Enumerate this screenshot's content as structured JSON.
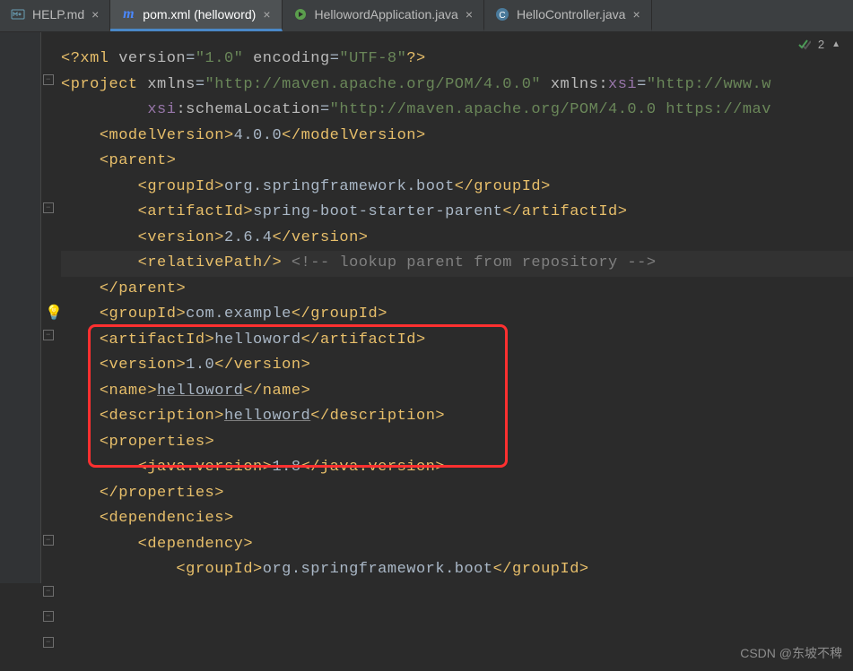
{
  "tabs": [
    {
      "label": "HELP.md",
      "active": false,
      "icon": "md"
    },
    {
      "label": "pom.xml (helloword)",
      "active": true,
      "icon": "maven"
    },
    {
      "label": "HellowordApplication.java",
      "active": false,
      "icon": "spring"
    },
    {
      "label": "HelloController.java",
      "active": false,
      "icon": "class"
    }
  ],
  "inspection": {
    "count": "2"
  },
  "code": {
    "xml_decl_kw": "?xml",
    "xml_decl_version_attr": "version",
    "xml_decl_version_val": "\"1.0\"",
    "xml_decl_enc_attr": "encoding",
    "xml_decl_enc_val": "\"UTF-8\"",
    "project": "project",
    "xmlns_attr": "xmlns",
    "xmlns_val": "\"http://maven.apache.org/POM/4.0.0\"",
    "xmlns_xsi_prefix": "xmlns:",
    "xmlns_xsi_name": "xsi",
    "xmlns_xsi_val": "\"http://www.w",
    "xsi_prefix": "xsi",
    "schema_attr": ":schemaLocation",
    "schema_val": "\"http://maven.apache.org/POM/4.0.0 https://mav",
    "modelVersion_tag": "modelVersion",
    "modelVersion_val": "4.0.0",
    "parent_tag": "parent",
    "groupId_tag": "groupId",
    "parent_groupId_val": "org.springframework.boot",
    "artifactId_tag": "artifactId",
    "parent_artifactId_val": "spring-boot-starter-parent",
    "version_tag": "version",
    "parent_version_val": "2.6.4",
    "relativePath_tag": "relativePath",
    "relativePath_cmt": "<!-- lookup parent from repository -->",
    "proj_groupId_val": "com.example",
    "proj_artifactId_val": "helloword",
    "proj_version_val": "1.0",
    "name_tag": "name",
    "proj_name_val": "helloword",
    "description_tag": "description",
    "proj_desc_val": "helloword",
    "properties_tag": "properties",
    "javaver_tag": "java.version",
    "javaver_val": "1.8",
    "dependencies_tag": "dependencies",
    "dependency_tag": "dependency",
    "dep_groupId_val": "org.springframework.boot"
  },
  "watermark": "CSDN @东坡不稗"
}
